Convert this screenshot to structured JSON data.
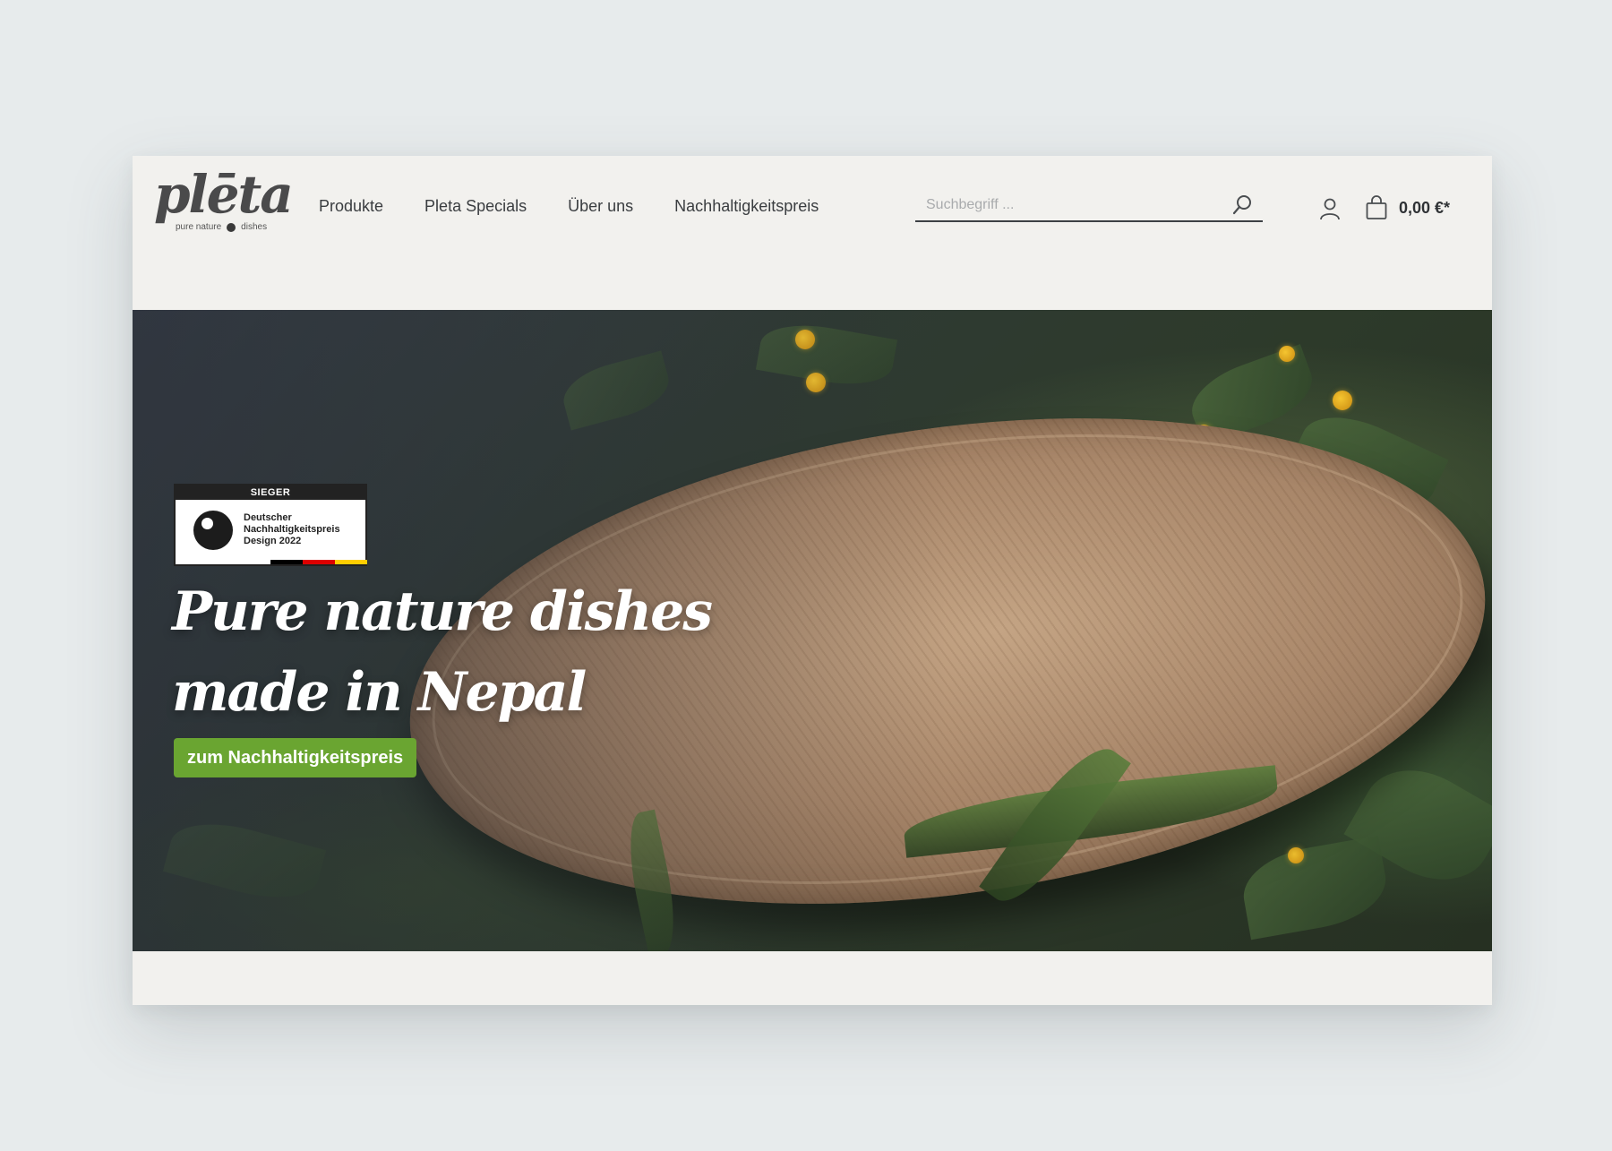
{
  "brand": {
    "name": "plēta",
    "tagline_left": "pure nature",
    "tagline_right": "dishes"
  },
  "nav": {
    "items": [
      {
        "label": "Produkte"
      },
      {
        "label": "Pleta Specials"
      },
      {
        "label": "Über uns"
      },
      {
        "label": "Nachhaltigkeitspreis"
      }
    ]
  },
  "search": {
    "placeholder": "Suchbegriff ...",
    "value": "",
    "icon": "search-icon"
  },
  "account": {
    "icon": "user-icon"
  },
  "cart": {
    "icon": "shopping-bag-icon",
    "total": "0,00 €*"
  },
  "hero": {
    "award": {
      "header": "SIEGER",
      "line1": "Deutscher",
      "line2": "Nachhaltigkeitspreis",
      "line3": "Design 2022",
      "flag_colors": [
        "#000000",
        "#dd0000",
        "#ffce00"
      ]
    },
    "title_line1": "Pure nature dishes",
    "title_line2": "made in Nepal",
    "cta_label": "zum Nachhaltigkeitspreis"
  },
  "colors": {
    "accent_green": "#6aa531",
    "text_dark": "#3a3d40",
    "header_bg": "#f2f1ee",
    "page_bg": "#e7ebec"
  }
}
